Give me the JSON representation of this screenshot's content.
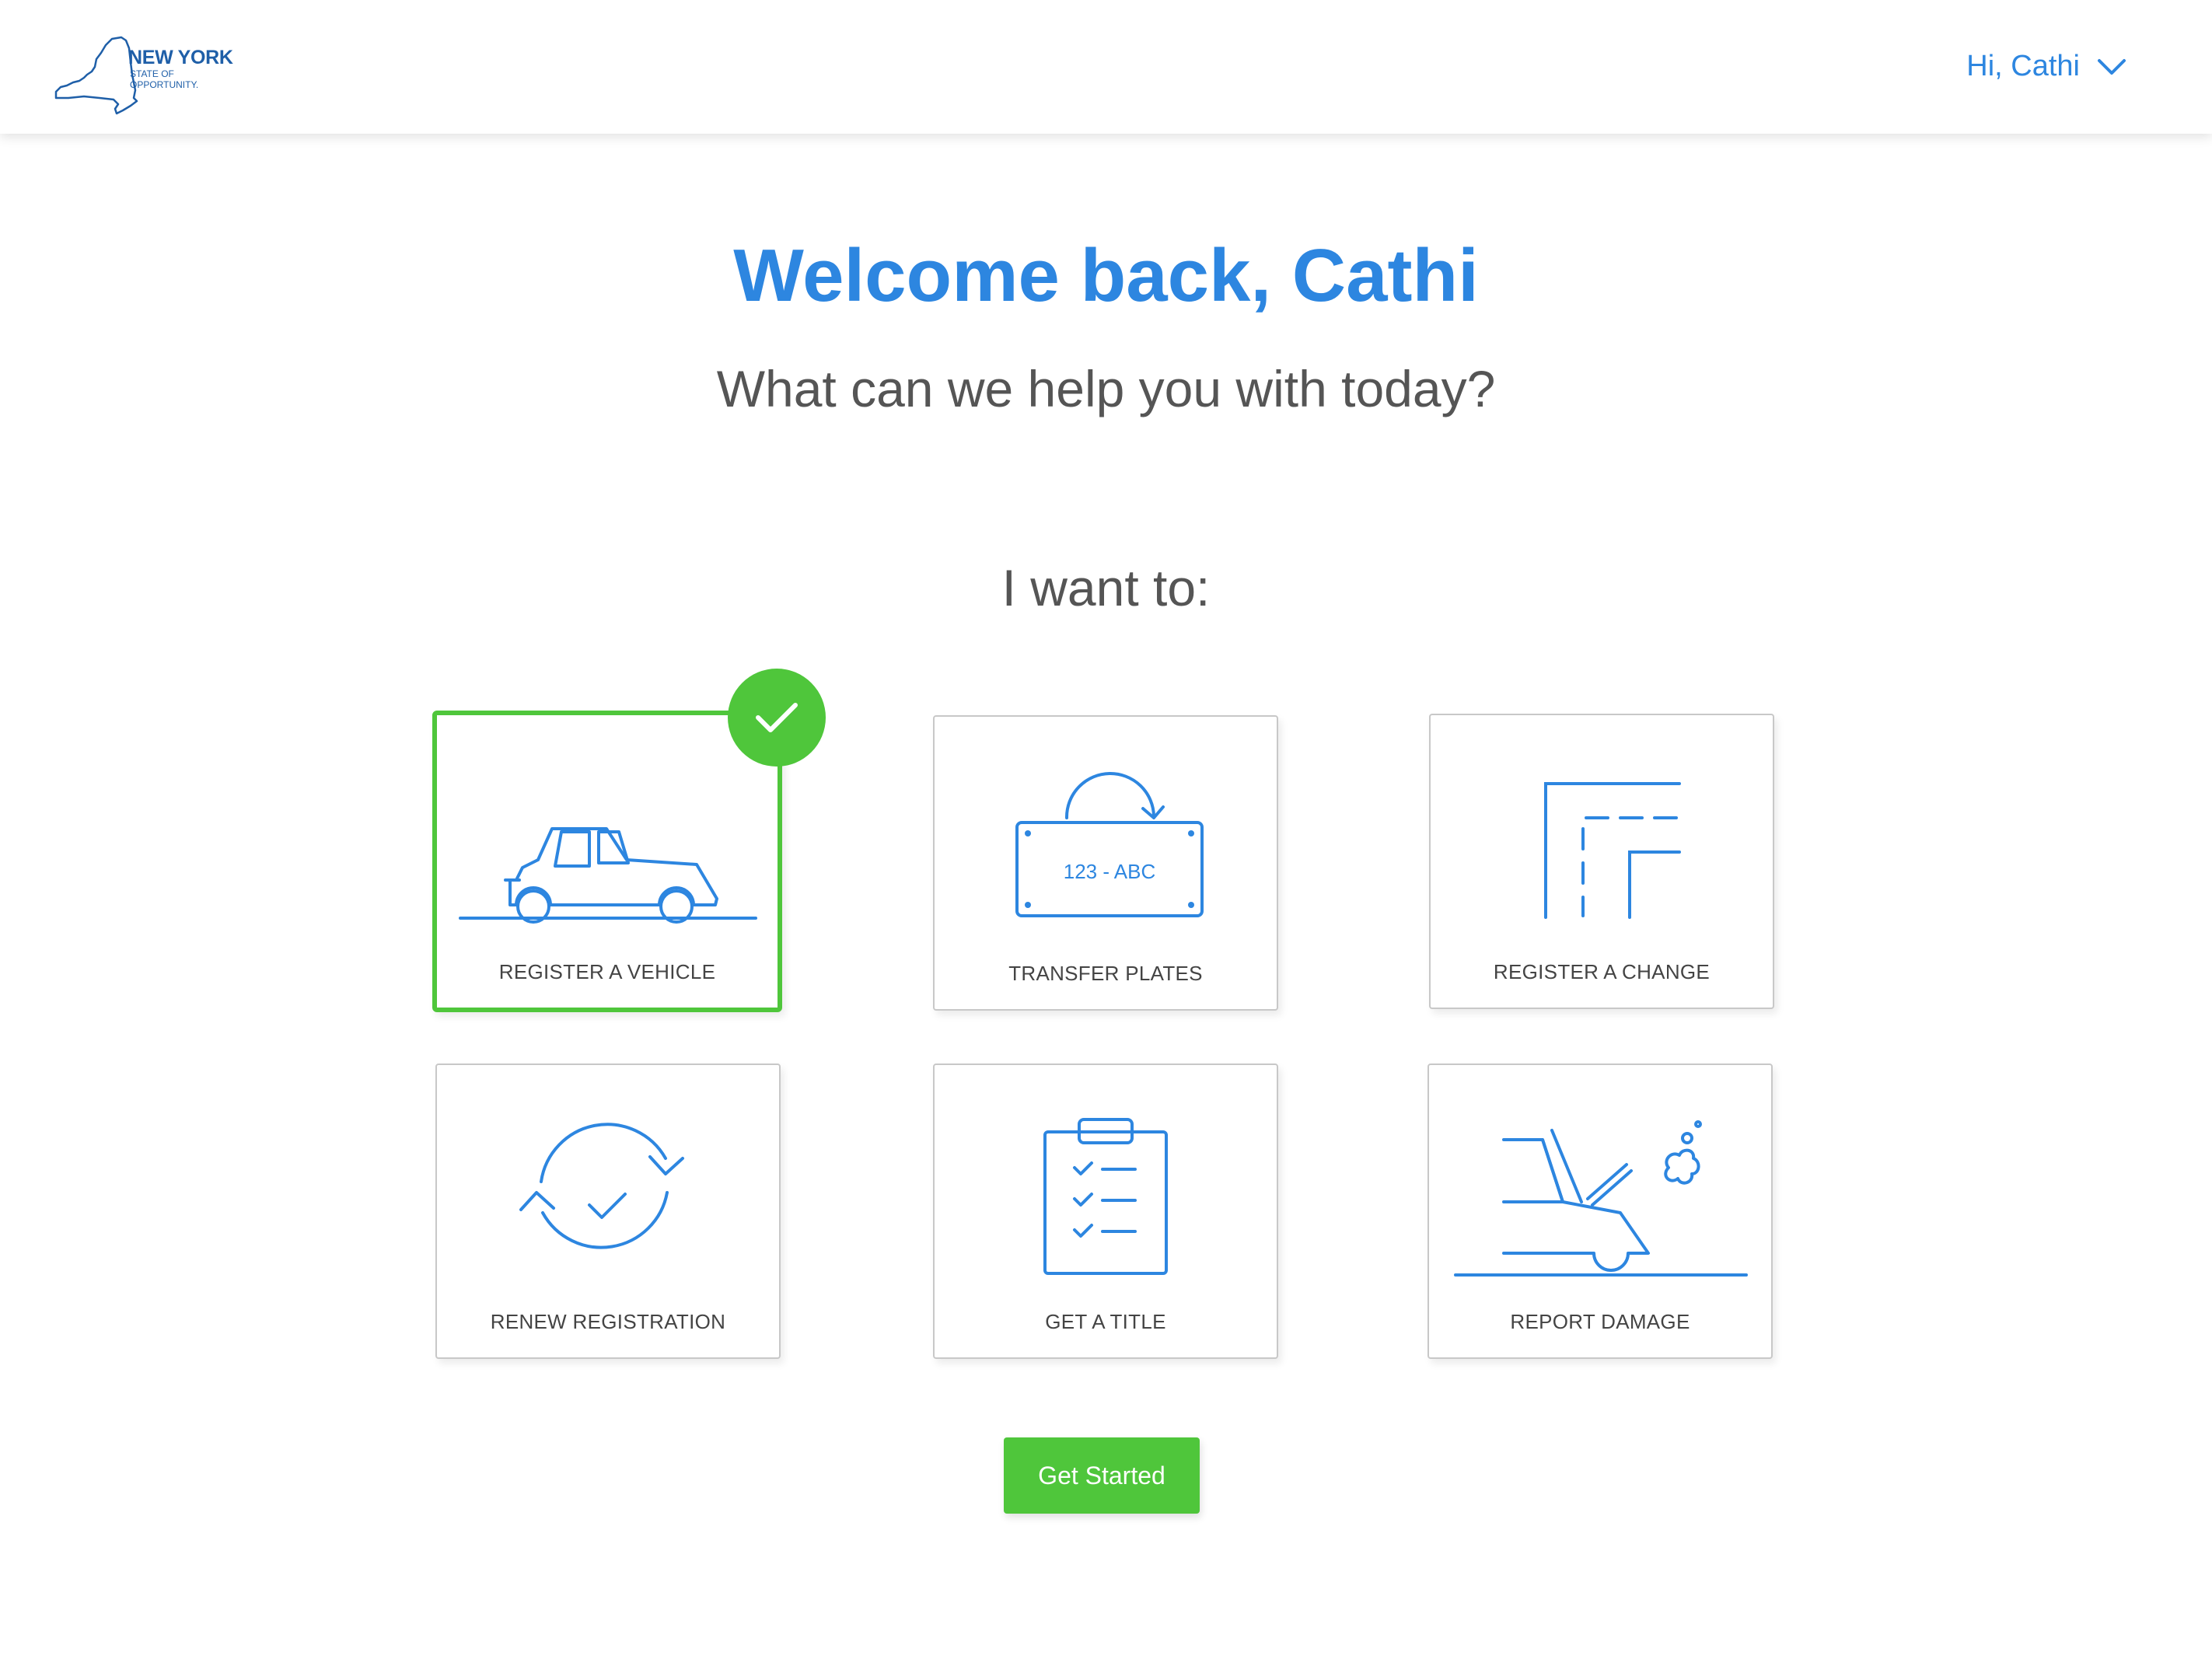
{
  "header": {
    "logo": {
      "name": "NEW YORK",
      "line1": "STATE OF",
      "line2": "OPPORTUNITY."
    },
    "user_greeting": "Hi, Cathi"
  },
  "main": {
    "title": "Welcome back, Cathi",
    "subtitle": "What can we help you with today?",
    "prompt": "I want to:"
  },
  "options": [
    {
      "label": "REGISTER A VEHICLE",
      "icon": "car-icon",
      "selected": true
    },
    {
      "label": "TRANSFER PLATES",
      "icon": "license-plate-icon",
      "plate_text": "123 - ABC",
      "selected": false
    },
    {
      "label": "REGISTER A CHANGE",
      "icon": "road-turn-icon",
      "selected": false
    },
    {
      "label": "RENEW REGISTRATION",
      "icon": "renew-cycle-icon",
      "selected": false
    },
    {
      "label": "GET A TITLE",
      "icon": "clipboard-checklist-icon",
      "selected": false
    },
    {
      "label": "REPORT DAMAGE",
      "icon": "car-crash-icon",
      "selected": false
    }
  ],
  "actions": {
    "get_started": "Get Started"
  },
  "colors": {
    "brand_blue": "#2d86e0",
    "accent_green": "#4fc63b",
    "text_gray": "#555555"
  }
}
